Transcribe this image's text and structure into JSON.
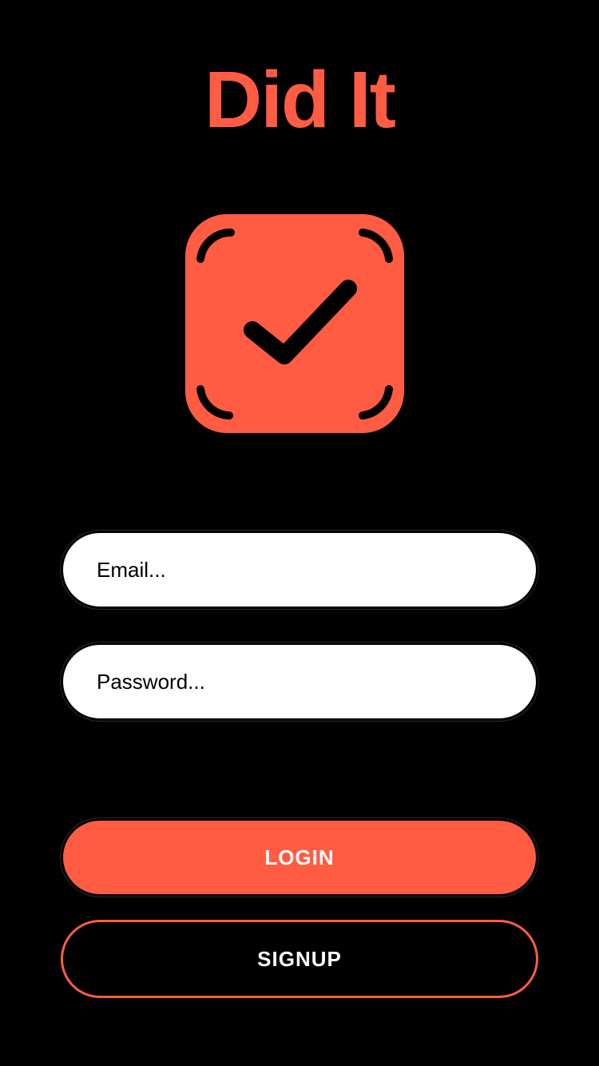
{
  "app": {
    "title": "Did It"
  },
  "logo": {
    "icon": "checkbox-check-icon",
    "color": "#FF5C43"
  },
  "form": {
    "email": {
      "value": "",
      "placeholder": "Email..."
    },
    "password": {
      "value": "",
      "placeholder": "Password..."
    }
  },
  "buttons": {
    "login_label": "LOGIN",
    "signup_label": "SIGNUP"
  },
  "colors": {
    "background": "#000000",
    "accent": "#FF5C43",
    "field_background": "#FFFFFF",
    "button_text": "#FFFFFF"
  }
}
